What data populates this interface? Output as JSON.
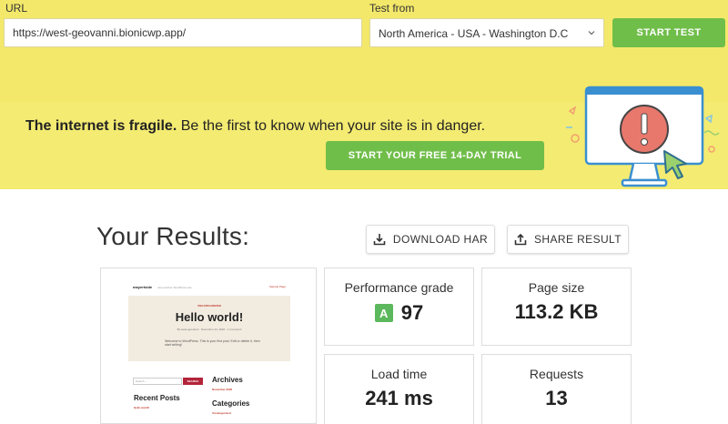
{
  "form": {
    "url_label": "URL",
    "url_value": "https://west-geovanni.bionicwp.app/",
    "location_label": "Test from",
    "location_value": "North America - USA - Washington D.C",
    "start_button": "START TEST"
  },
  "promo": {
    "headline_bold": "The internet is fragile.",
    "headline_rest": " Be the first to know when your site is in danger.",
    "trial_button": "START YOUR FREE 14-DAY TRIAL"
  },
  "results": {
    "title": "Your Results:",
    "download_button": "DOWNLOAD HAR",
    "share_button": "SHARE RESULT",
    "performance_label": "Performance grade",
    "grade_letter": "A",
    "grade_score": "97",
    "page_size_label": "Page size",
    "page_size_value": "113.2 KB",
    "load_time_label": "Load time",
    "load_time_value": "241 ms",
    "requests_label": "Requests",
    "requests_value": "13"
  },
  "preview": {
    "brand": "mayertside",
    "tagline": "Just another WordPress site",
    "nav": "Sample Page",
    "category": "UNCATEGORIZED",
    "post_title": "Hello world!",
    "meta": "By west-geovanni · November 24, 2020 · 1 Comment",
    "body": "Welcome to WordPress. This is your first post. Edit or delete it, then start writing!",
    "search_placeholder": "Search ...",
    "search_button": "SEARCH",
    "recent_posts": "Recent Posts",
    "recent_link": "Hello world!",
    "archives": "Archives",
    "archive_link": "November 2020",
    "categories": "Categories",
    "category_link": "Uncategorized"
  },
  "colors": {
    "banner": "#f3e86a",
    "accent_green": "#70be4a",
    "grade_green": "#5cb85c",
    "alert_red": "#e8786c"
  },
  "icons": {
    "chevron": "chevron-down-icon",
    "download": "download-icon",
    "share": "share-icon",
    "illustration": "monitor-alert-icon"
  }
}
